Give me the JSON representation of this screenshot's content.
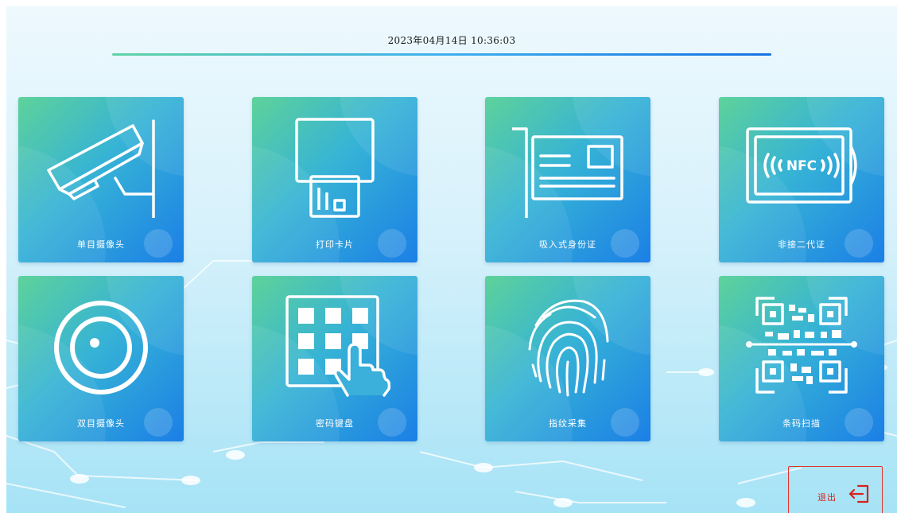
{
  "header": {
    "datetime": "2023年04月14日 10:36:03"
  },
  "tiles": [
    {
      "label": "单目摄像头",
      "icon": "security-camera-icon"
    },
    {
      "label": "打印卡片",
      "icon": "card-printer-icon"
    },
    {
      "label": "吸入式身份证",
      "icon": "id-card-reader-icon"
    },
    {
      "label": "非接二代证",
      "icon": "nfc-card-icon"
    },
    {
      "label": "双目摄像头",
      "icon": "camera-lens-icon"
    },
    {
      "label": "密码键盘",
      "icon": "keypad-icon"
    },
    {
      "label": "指纹采集",
      "icon": "fingerprint-icon"
    },
    {
      "label": "条码扫描",
      "icon": "qr-code-scan-icon"
    }
  ],
  "exit": {
    "label": "退出",
    "icon": "exit-icon"
  },
  "colors": {
    "tile_gradient_start": "#5ed29a",
    "tile_gradient_end": "#1b7fe6",
    "exit_red": "#d8231c",
    "background_top": "#eef9fe",
    "background_bottom": "#a6e3f6"
  }
}
